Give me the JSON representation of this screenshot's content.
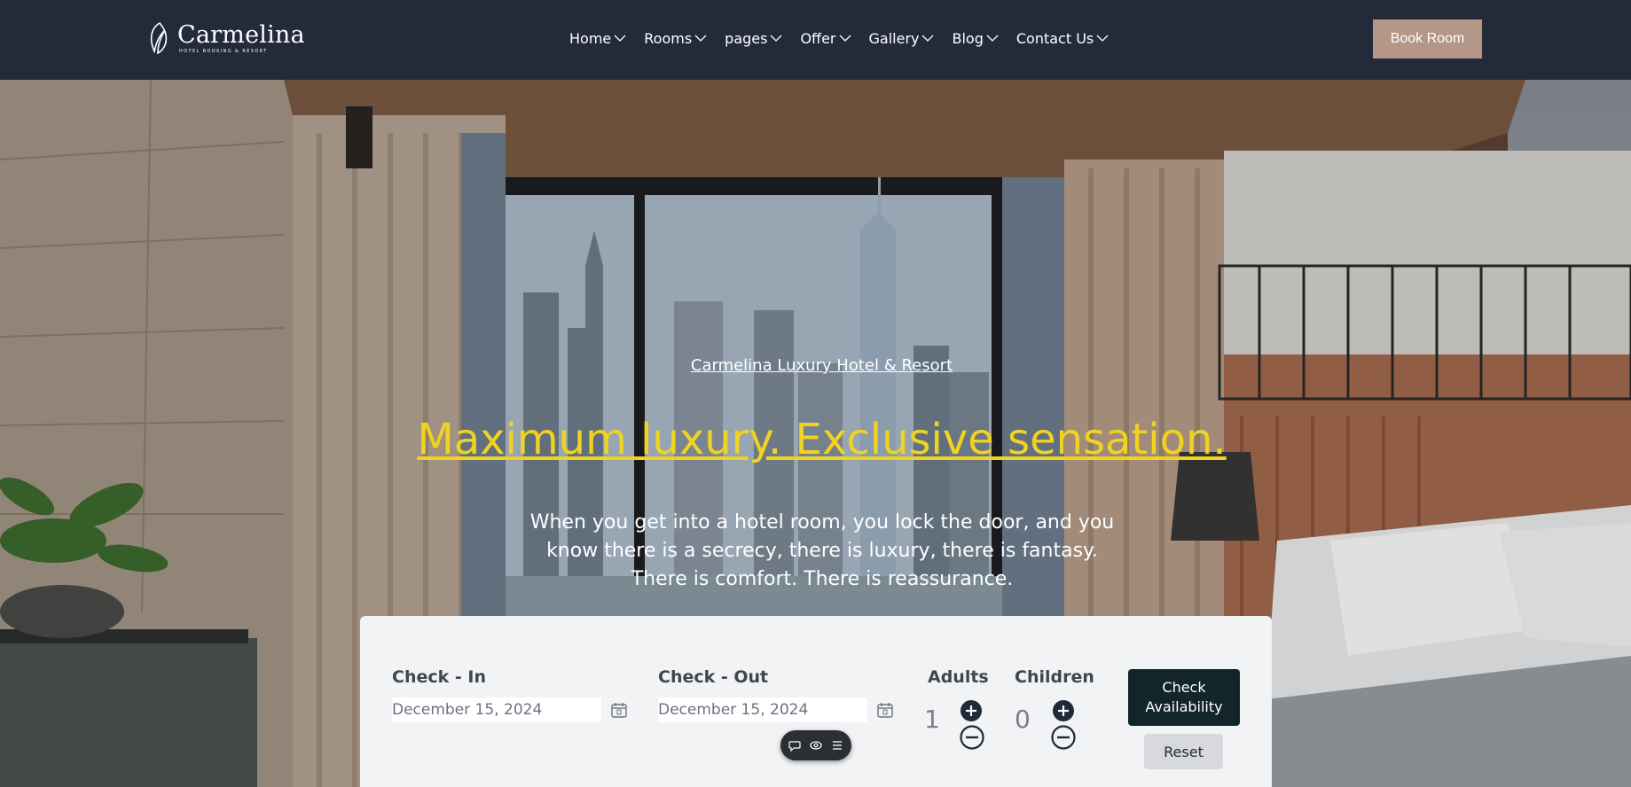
{
  "header": {
    "logo": {
      "name": "Carmelina",
      "tagline": "HOTEL BOOKING & RESORT"
    },
    "nav": [
      {
        "label": "Home"
      },
      {
        "label": "Rooms"
      },
      {
        "label": "pages"
      },
      {
        "label": "Offer"
      },
      {
        "label": "Gallery"
      },
      {
        "label": "Blog"
      },
      {
        "label": "Contact Us"
      }
    ],
    "book_button": "Book Room"
  },
  "hero": {
    "subtitle": "Carmelina Luxury Hotel & Resort",
    "title": "Maximum luxury. Exclusive sensation.",
    "description": "When you get into a hotel room, you lock the door, and you know there is a secrecy, there is luxury, there is fantasy. There is comfort. There is reassurance."
  },
  "booking": {
    "check_in_label": "Check - In",
    "check_in_value": "December 15, 2024",
    "check_out_label": "Check - Out",
    "check_out_value": "December 15, 2024",
    "adults_label": "Adults",
    "adults_value": "1",
    "children_label": "Children",
    "children_value": "0",
    "check_button": "Check Availability",
    "reset_button": "Reset"
  },
  "colors": {
    "header_bg": "#232a3a",
    "accent": "#b59787",
    "title_yellow": "#f0d321",
    "check_button_bg": "#12252a"
  },
  "icons": {
    "nav_chevron": "chevron-down-icon",
    "calendar": "calendar-icon",
    "plus": "plus-circle-icon",
    "minus": "minus-circle-icon",
    "toolbar": [
      "chat-icon",
      "eye-icon",
      "menu-icon"
    ]
  }
}
